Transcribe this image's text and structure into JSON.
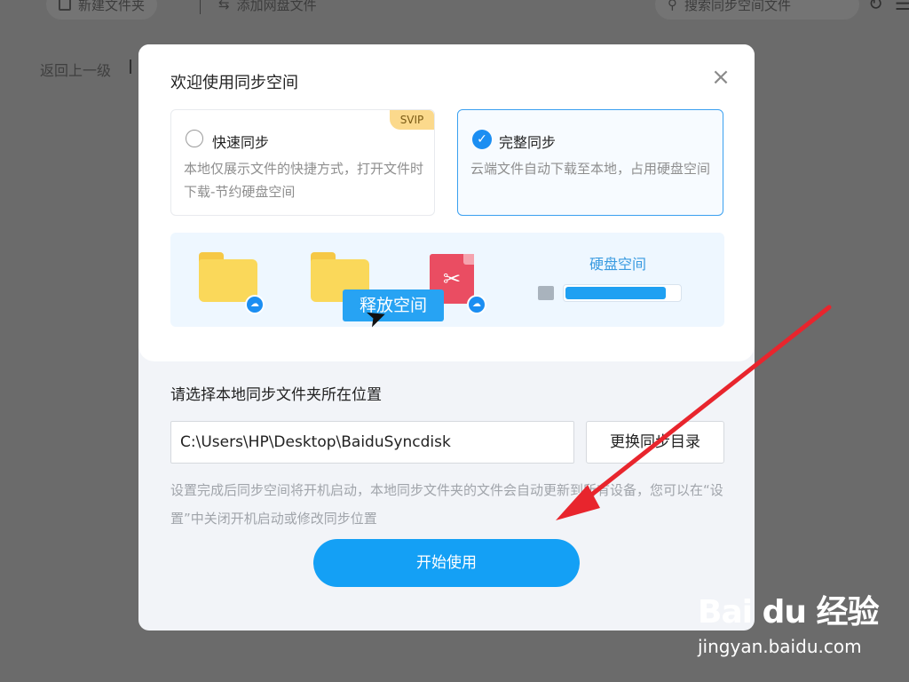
{
  "background": {
    "toolbar": {
      "new_folder_label": "新建文件夹",
      "add_netdisk_label": "添加网盘文件",
      "search_placeholder": "搜索同步空间文件"
    },
    "back_label": "返回上一级"
  },
  "dialog": {
    "title": "欢迎使用同步空间",
    "close_icon": "close-icon",
    "options": [
      {
        "title": "快速同步",
        "description": "本地仅展示文件的快捷方式，打开文件时下载-节约硬盘空间",
        "badge": "SVIP",
        "selected": false
      },
      {
        "title": "完整同步",
        "description": "云端文件自动下载至本地，占用硬盘空间",
        "selected": true
      }
    ],
    "illustration": {
      "release_label": "释放空间",
      "disk_label": "硬盘空间",
      "disk_usage_fraction": 0.88
    },
    "location_label": "请选择本地同步文件夹所在位置",
    "path_value": "C:\\Users\\HP\\Desktop\\BaiduSyncdisk",
    "change_dir_label": "更换同步目录",
    "hint": "设置完成后同步空间将开机启动，本地同步文件夹的文件会自动更新到所有设备，您可以在“设置”中关闭开机启动或修改同步位置",
    "start_label": "开始使用"
  },
  "overlay": {
    "arrow_color": "#e8252d",
    "watermark_brand": "Bai du 经验",
    "watermark_url": "jingyan.baidu.com"
  }
}
